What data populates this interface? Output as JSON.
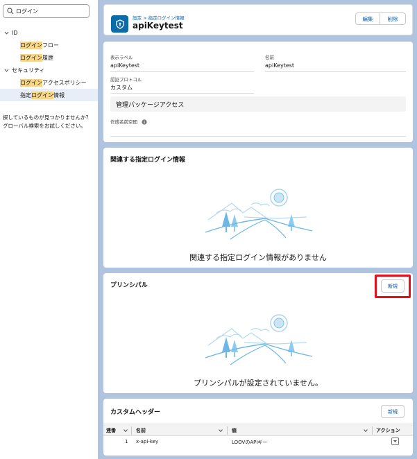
{
  "sidebar": {
    "search": {
      "value": "ログイン",
      "placeholder": ""
    },
    "groups": [
      {
        "label": "ID"
      },
      {
        "label": "セキュリティ"
      }
    ],
    "items": [
      {
        "hl": "ログイン",
        "rest": "フロー"
      },
      {
        "hl": "ログイン",
        "rest": "履歴"
      },
      {
        "hl": "ログイン",
        "rest": "アクセスポリシー"
      },
      {
        "pre": "指定",
        "hl": "ログイン",
        "rest": "情報"
      }
    ],
    "help_line1": "探しているものが見つかりませんか?",
    "help_line2": "グローバル検索をお試しください。"
  },
  "header": {
    "breadcrumb": "設定 > 指定ログイン情報",
    "title": "apiKeytest",
    "edit_label": "編集",
    "delete_label": "削除"
  },
  "details": {
    "label_label": "表示ラベル",
    "label_value": "apiKeytest",
    "name_label": "名前",
    "name_value": "apiKeytest",
    "protocol_label": "認証プロトコル",
    "protocol_value": "カスタム",
    "section_title": "管理パッケージアクセス",
    "namespace_label": "作成名前空間"
  },
  "related": {
    "title": "関連する指定ログイン情報",
    "empty_text": "関連する指定ログイン情報がありません"
  },
  "principals": {
    "title": "プリンシパル",
    "new_label": "新規",
    "empty_text": "プリンシパルが設定されていません。"
  },
  "custom_headers": {
    "title": "カスタムヘッダー",
    "new_label": "新規",
    "columns": [
      "連番",
      "名前",
      "値",
      "アクション"
    ],
    "rows": [
      {
        "seq": "1",
        "name": "x-api-key",
        "value": "LOOVのAPIキー"
      }
    ]
  },
  "colors": {
    "brand": "#0b6aa8",
    "link": "#0b5cab",
    "highlight": "#f4d58a",
    "annotation_red": "#e3101a",
    "background": "#b0c4df"
  }
}
